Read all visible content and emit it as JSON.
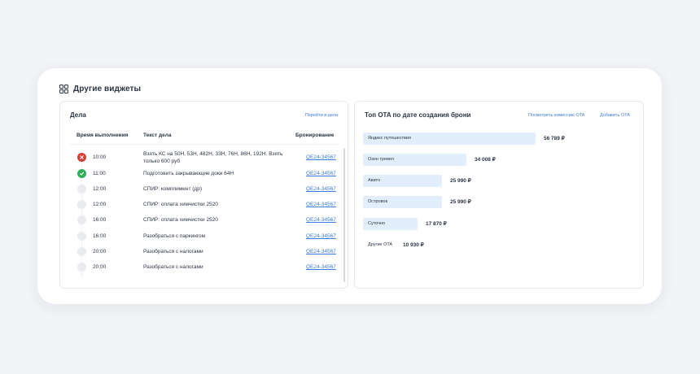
{
  "widget": {
    "title": "Другие виджеты",
    "icon": "grid-icon"
  },
  "tasks": {
    "title": "Дела",
    "link": "Перейти в дела",
    "columns": {
      "time": "Время выполнения",
      "text": "Текст дела",
      "booking": "Бронирование"
    },
    "rows": [
      {
        "status": "failed",
        "time": "10:00",
        "text": "Взять КС на 50Н, 53Н, 482Н, 33Н, 76Н, 86Н, 192Н. Взять только 600 руб",
        "booking": "QE24-34567"
      },
      {
        "status": "done",
        "time": "11:00",
        "text": "Подготовить закрывающие доки 64Н",
        "booking": "QE24-34567"
      },
      {
        "status": "pending",
        "time": "12:00",
        "text": "СПИР: комплимент (др)",
        "booking": "QE24-34567"
      },
      {
        "status": "pending",
        "time": "12:00",
        "text": "СПИР: оплата химчистки 2520",
        "booking": "QE24-34567"
      },
      {
        "status": "pending",
        "time": "16:00",
        "text": "СПИР: оплата химчистки 2520",
        "booking": "QE24-34567"
      },
      {
        "status": "pending",
        "time": "16:00",
        "text": "Разобраться с паркингом",
        "booking": "QE24-34567"
      },
      {
        "status": "pending",
        "time": "20:00",
        "text": "Разобраться с налогами",
        "booking": "QE24-34567"
      },
      {
        "status": "pending",
        "time": "20:00",
        "text": "Разобраться с налогами",
        "booking": "QE24-34567"
      }
    ]
  },
  "ota": {
    "title": "Топ OTA по дате создания брони",
    "link_commission": "Посмотреть комиссию OTA",
    "link_add": "Добавить OTA",
    "bar_color": "#e3eefc",
    "items": [
      {
        "name": "Яндекс путешествия",
        "value": "56 789 ₽",
        "amount": 56789
      },
      {
        "name": "Озон тревел",
        "value": "34 008 ₽",
        "amount": 34008
      },
      {
        "name": "Авито",
        "value": "25 990 ₽",
        "amount": 25990
      },
      {
        "name": "Островок",
        "value": "25 990 ₽",
        "amount": 25990
      },
      {
        "name": "Суточно",
        "value": "17 870 ₽",
        "amount": 17870
      },
      {
        "name": "Другие OTA",
        "value": "10 930 ₽",
        "amount": 10930
      }
    ]
  },
  "colors": {
    "accent": "#3b7ddd",
    "failed": "#d93c34",
    "done": "#2fae58",
    "pending": "#e9ebef"
  }
}
